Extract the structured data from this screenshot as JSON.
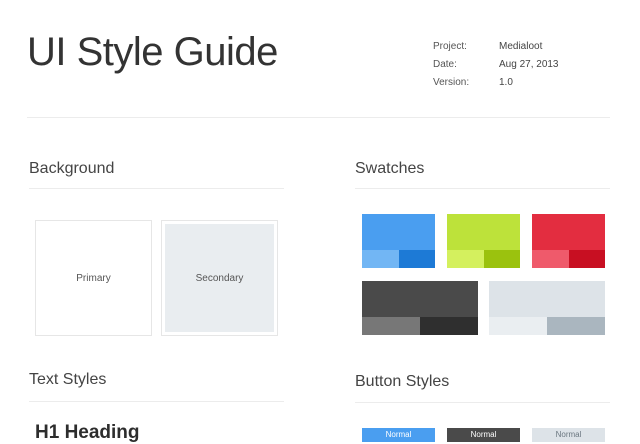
{
  "header": {
    "title": "UI Style Guide",
    "meta": [
      {
        "key": "Project:",
        "value": "Medialoot"
      },
      {
        "key": "Date:",
        "value": "Aug 27, 2013"
      },
      {
        "key": "Version:",
        "value": "1.0"
      }
    ]
  },
  "background": {
    "heading": "Background",
    "primary_label": "Primary",
    "secondary_label": "Secondary"
  },
  "swatches": {
    "heading": "Swatches",
    "colors": {
      "blue": "#4a9ef0",
      "blue_light": "#72b6f4",
      "blue_dark": "#1d7ad6",
      "green": "#bde23a",
      "green_light": "#d4f05e",
      "green_dark": "#9bc20e",
      "red": "#e32d40",
      "red_light": "#ef5a6b",
      "red_dark": "#c80f22",
      "charcoal": "#4a4a4a",
      "charcoal_light": "#777777",
      "charcoal_dark": "#2f2f2f",
      "silver": "#dde3e8",
      "silver_light": "#eaeef1",
      "silver_dark": "#aab6bf"
    }
  },
  "text_styles": {
    "heading": "Text Styles",
    "h1_sample": "H1 Heading"
  },
  "button_styles": {
    "heading": "Button Styles",
    "buttons": [
      "Normal",
      "Normal",
      "Normal"
    ]
  }
}
